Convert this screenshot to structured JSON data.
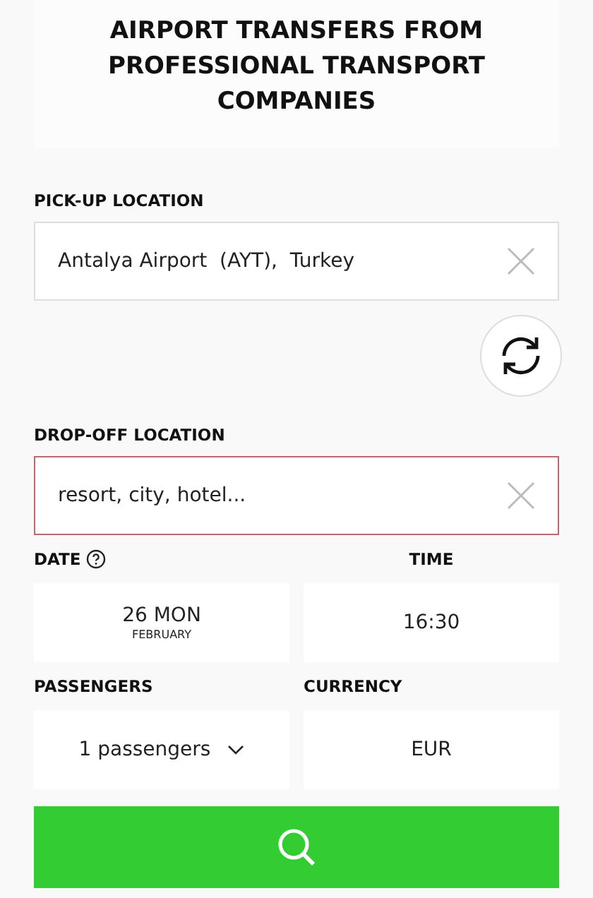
{
  "title": "AIRPORT TRANSFERS FROM PROFESSIONAL TRANSPORT COMPANIES",
  "locations": [
    {
      "label": "PICK-UP LOCATION",
      "value": "Antalya Airport  (AYT),  Turkey",
      "invalid": false
    },
    {
      "label": "DROP-OFF LOCATION",
      "placeholder": "resort, city, hotel...",
      "invalid": true
    }
  ],
  "date": {
    "label": "DATE",
    "day": "26 MON",
    "month": "FEBRUARY"
  },
  "time": {
    "label": "TIME",
    "value": "16:30"
  },
  "passengers": {
    "label": "PASSENGERS",
    "value": "1  passengers"
  },
  "currency": {
    "label": "CURRENCY",
    "value": "EUR"
  }
}
